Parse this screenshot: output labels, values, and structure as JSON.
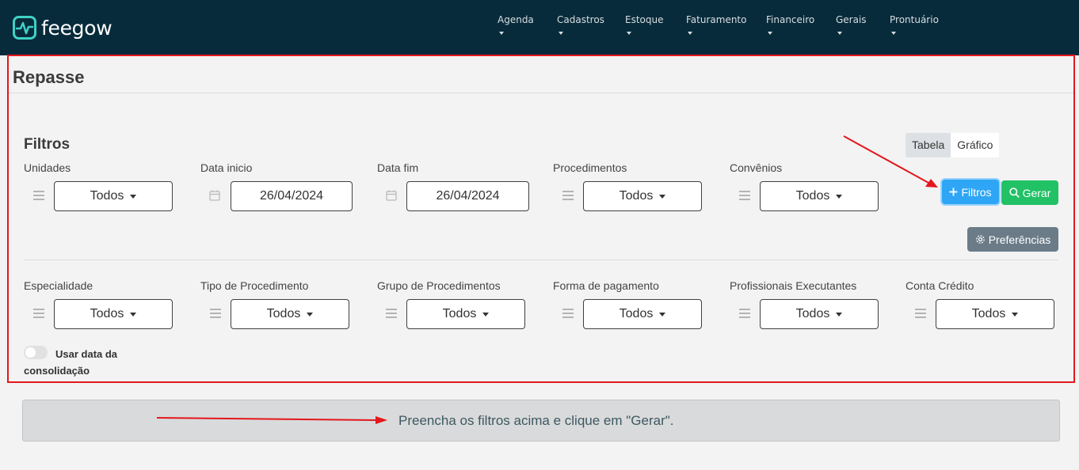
{
  "brand": {
    "name": "feegow"
  },
  "nav": {
    "items": [
      {
        "label": "Agenda"
      },
      {
        "label": "Cadastros"
      },
      {
        "label": "Estoque"
      },
      {
        "label": "Faturamento"
      },
      {
        "label": "Financeiro"
      },
      {
        "label": "Gerais"
      },
      {
        "label": "Prontuário"
      }
    ]
  },
  "page": {
    "title": "Repasse"
  },
  "filters": {
    "title": "Filtros",
    "view_toggle": {
      "table_label": "Tabela",
      "chart_label": "Gráfico",
      "selected": "Tabela"
    },
    "row1": [
      {
        "label": "Unidades",
        "value": "Todos",
        "kind": "select"
      },
      {
        "label": "Data inicio",
        "value": "26/04/2024",
        "kind": "date"
      },
      {
        "label": "Data fim",
        "value": "26/04/2024",
        "kind": "date"
      },
      {
        "label": "Procedimentos",
        "value": "Todos",
        "kind": "select"
      },
      {
        "label": "Convênios",
        "value": "Todos",
        "kind": "select"
      }
    ],
    "row2": [
      {
        "label": "Especialidade",
        "value": "Todos"
      },
      {
        "label": "Tipo de Procedimento",
        "value": "Todos"
      },
      {
        "label": "Grupo de Procedimentos",
        "value": "Todos"
      },
      {
        "label": "Forma de pagamento",
        "value": "Todos"
      },
      {
        "label": "Profissionais Executantes",
        "value": "Todos"
      },
      {
        "label": "Conta Crédito",
        "value": "Todos"
      }
    ],
    "buttons": {
      "filtros": "Filtros",
      "gerar": "Gerar",
      "preferencias": "Preferências"
    },
    "consolidation_toggle": {
      "label_line1": "Usar data da",
      "label_line2": "consolidação",
      "on": false
    }
  },
  "results": {
    "empty_message": "Preencha os filtros acima e clique em \"Gerar\"."
  },
  "colors": {
    "nav_bg": "#082b3b",
    "primary": "#2fa6f5",
    "success": "#21c165",
    "secondary": "#6b7c88",
    "annotation": "#e3171c"
  }
}
